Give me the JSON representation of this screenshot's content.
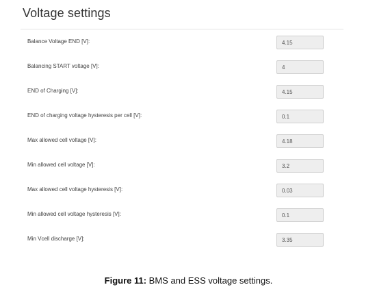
{
  "panel": {
    "title": "Voltage settings",
    "rows": [
      {
        "label": "Balance Voltage END [V]:",
        "value": "4.15"
      },
      {
        "label": "Balancing START voltage [V]:",
        "value": "4"
      },
      {
        "label": "END of Charging [V]:",
        "value": "4.15"
      },
      {
        "label": "END of charging voltage hysteresis per cell [V]:",
        "value": "0.1"
      },
      {
        "label": "Max allowed cell voltage [V]:",
        "value": "4.18"
      },
      {
        "label": "Min allowed cell voltage [V]:",
        "value": "3.2"
      },
      {
        "label": "Max allowed cell voltage hysteresis [V]:",
        "value": "0.03"
      },
      {
        "label": "Min allowed cell voltage hysteresis [V]:",
        "value": "0.1"
      },
      {
        "label": "Min Vcell discharge [V]:",
        "value": "3.35"
      }
    ]
  },
  "caption": {
    "label": "Figure 11:",
    "text": " BMS and ESS voltage settings."
  }
}
